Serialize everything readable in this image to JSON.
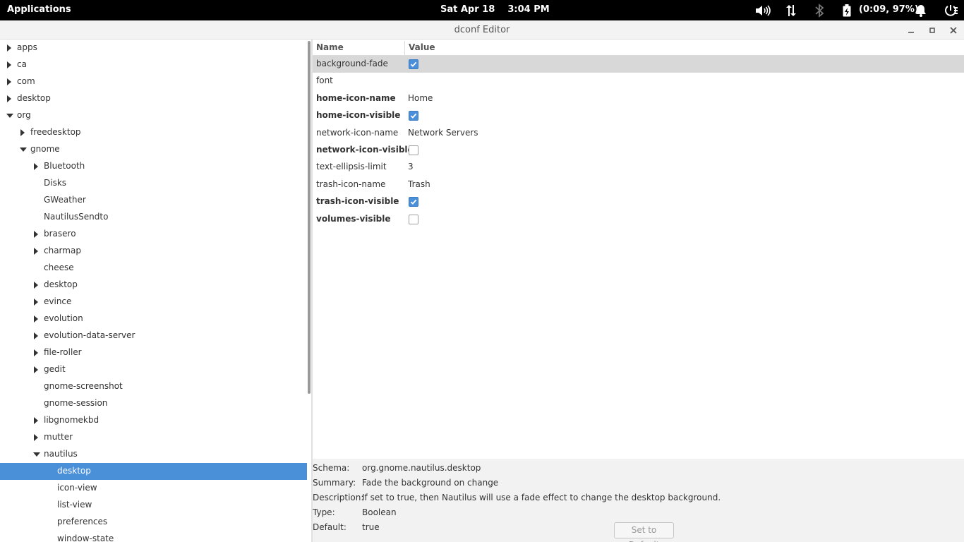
{
  "panel": {
    "applications_label": "Applications",
    "clock": "Sat Apr 18    3:04 PM",
    "battery_text": "(0:09, 97%)",
    "icons": [
      "volume-icon",
      "network-icon",
      "bluetooth-icon",
      "battery-icon",
      "notifications-icon",
      "system-menu-icon"
    ]
  },
  "window": {
    "title": "dconf Editor"
  },
  "tree": [
    {
      "label": "apps",
      "depth": 0,
      "arrow": "collapsed"
    },
    {
      "label": "ca",
      "depth": 0,
      "arrow": "collapsed"
    },
    {
      "label": "com",
      "depth": 0,
      "arrow": "collapsed"
    },
    {
      "label": "desktop",
      "depth": 0,
      "arrow": "collapsed"
    },
    {
      "label": "org",
      "depth": 0,
      "arrow": "expanded"
    },
    {
      "label": "freedesktop",
      "depth": 1,
      "arrow": "collapsed"
    },
    {
      "label": "gnome",
      "depth": 1,
      "arrow": "expanded"
    },
    {
      "label": "Bluetooth",
      "depth": 2,
      "arrow": "collapsed"
    },
    {
      "label": "Disks",
      "depth": 2,
      "arrow": "none"
    },
    {
      "label": "GWeather",
      "depth": 2,
      "arrow": "none"
    },
    {
      "label": "NautilusSendto",
      "depth": 2,
      "arrow": "none"
    },
    {
      "label": "brasero",
      "depth": 2,
      "arrow": "collapsed"
    },
    {
      "label": "charmap",
      "depth": 2,
      "arrow": "collapsed"
    },
    {
      "label": "cheese",
      "depth": 2,
      "arrow": "none"
    },
    {
      "label": "desktop",
      "depth": 2,
      "arrow": "collapsed"
    },
    {
      "label": "evince",
      "depth": 2,
      "arrow": "collapsed"
    },
    {
      "label": "evolution",
      "depth": 2,
      "arrow": "collapsed"
    },
    {
      "label": "evolution-data-server",
      "depth": 2,
      "arrow": "collapsed"
    },
    {
      "label": "file-roller",
      "depth": 2,
      "arrow": "collapsed"
    },
    {
      "label": "gedit",
      "depth": 2,
      "arrow": "collapsed"
    },
    {
      "label": "gnome-screenshot",
      "depth": 2,
      "arrow": "none"
    },
    {
      "label": "gnome-session",
      "depth": 2,
      "arrow": "none"
    },
    {
      "label": "libgnomekbd",
      "depth": 2,
      "arrow": "collapsed"
    },
    {
      "label": "mutter",
      "depth": 2,
      "arrow": "collapsed"
    },
    {
      "label": "nautilus",
      "depth": 2,
      "arrow": "expanded"
    },
    {
      "label": "desktop",
      "depth": 3,
      "arrow": "none",
      "selected": true
    },
    {
      "label": "icon-view",
      "depth": 3,
      "arrow": "none"
    },
    {
      "label": "list-view",
      "depth": 3,
      "arrow": "none"
    },
    {
      "label": "preferences",
      "depth": 3,
      "arrow": "none"
    },
    {
      "label": "window-state",
      "depth": 3,
      "arrow": "none"
    }
  ],
  "list": {
    "headers": {
      "name": "Name",
      "value": "Value"
    },
    "rows": [
      {
        "name": "background-fade",
        "bold": false,
        "type": "bool",
        "checked": true,
        "selected": true
      },
      {
        "name": "font",
        "bold": false,
        "type": "text",
        "value": ""
      },
      {
        "name": "home-icon-name",
        "bold": true,
        "type": "text",
        "value": "Home"
      },
      {
        "name": "home-icon-visible",
        "bold": true,
        "type": "bool",
        "checked": true
      },
      {
        "name": "network-icon-name",
        "bold": false,
        "type": "text",
        "value": "Network Servers"
      },
      {
        "name": "network-icon-visible",
        "bold": true,
        "type": "bool",
        "checked": false
      },
      {
        "name": "text-ellipsis-limit",
        "bold": false,
        "type": "text",
        "value": "3"
      },
      {
        "name": "trash-icon-name",
        "bold": false,
        "type": "text",
        "value": "Trash"
      },
      {
        "name": "trash-icon-visible",
        "bold": true,
        "type": "bool",
        "checked": true
      },
      {
        "name": "volumes-visible",
        "bold": true,
        "type": "bool",
        "checked": false
      }
    ]
  },
  "details": {
    "schema_label": "Schema:",
    "schema": "org.gnome.nautilus.desktop",
    "summary_label": "Summary:",
    "summary": "Fade the background on change",
    "description_label": "Description:",
    "description": "If set to true, then Nautilus will use a fade effect to change the desktop background.",
    "type_label": "Type:",
    "type": "Boolean",
    "default_label": "Default:",
    "default": "true",
    "set_default_label": "Set to Default"
  },
  "colors": {
    "selection": "#4a90d9",
    "row_highlight": "#d8d8d8",
    "panel_bg": "#000000"
  }
}
